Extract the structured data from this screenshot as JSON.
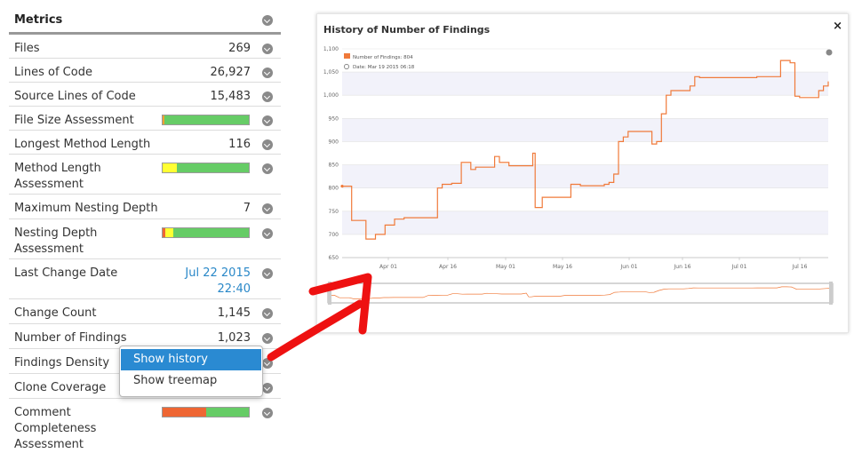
{
  "metrics": {
    "title": "Metrics",
    "rows": [
      {
        "label": "Files",
        "value": "269"
      },
      {
        "label": "Lines of Code",
        "value": "26,927"
      },
      {
        "label": "Source Lines of Code",
        "value": "15,483"
      },
      {
        "label": "File Size Assessment",
        "value": ""
      },
      {
        "label": "Longest Method Length",
        "value": "116"
      },
      {
        "label": "Method Length Assessment",
        "value": ""
      },
      {
        "label": "Maximum Nesting Depth",
        "value": "7"
      },
      {
        "label": "Nesting Depth Assessment",
        "value": ""
      },
      {
        "label": "Last Change Date",
        "value": "Jul 22 2015 22:40"
      },
      {
        "label": "Change Count",
        "value": "1,145"
      },
      {
        "label": "Number of Findings",
        "value": "1,023"
      },
      {
        "label": "Findings Density",
        "value": ""
      },
      {
        "label": "Clone Coverage",
        "value": ""
      },
      {
        "label": "Comment Completeness Assessment",
        "value": ""
      }
    ],
    "assessment_bars": {
      "file_size": [
        {
          "color": "#f0a030",
          "pct": 2
        },
        {
          "color": "#66cc66",
          "pct": 98
        }
      ],
      "method_length": [
        {
          "color": "#ffff33",
          "pct": 16
        },
        {
          "color": "#66cc66",
          "pct": 84
        }
      ],
      "nesting_depth": [
        {
          "color": "#ee6633",
          "pct": 3
        },
        {
          "color": "#ffff33",
          "pct": 9
        },
        {
          "color": "#66cc66",
          "pct": 88
        }
      ],
      "comment_completeness": [
        {
          "color": "#ee6633",
          "pct": 50
        },
        {
          "color": "#66cc66",
          "pct": 50
        }
      ]
    }
  },
  "context_menu": {
    "items": [
      {
        "label": "Show history",
        "selected": true
      },
      {
        "label": "Show treemap",
        "selected": false
      }
    ]
  },
  "history": {
    "title": "History of Number of Findings",
    "close": "×"
  },
  "chart_data": {
    "type": "line",
    "title": "History of Number of Findings",
    "legend": {
      "series": "Number of Findings: 804",
      "date": "Date: Mar 19 2015 06:18",
      "position": "top-left"
    },
    "y_ticks": [
      "1,100",
      "1,050",
      "1,000",
      "950",
      "900",
      "850",
      "800",
      "750",
      "700",
      "650"
    ],
    "ylim": [
      650,
      1100
    ],
    "x_ticks": [
      "Apr 01",
      "Apr 16",
      "May 01",
      "May 16",
      "Jun 01",
      "Jun 16",
      "Jul 01",
      "Jul 16"
    ],
    "grid": true,
    "series": [
      {
        "name": "Number of Findings",
        "color": "#f07a3a",
        "points": [
          [
            0,
            804
          ],
          [
            1,
            804
          ],
          [
            2,
            730
          ],
          [
            3,
            730
          ],
          [
            4,
            730
          ],
          [
            5,
            690
          ],
          [
            6,
            690
          ],
          [
            7,
            700
          ],
          [
            8,
            700
          ],
          [
            9,
            720
          ],
          [
            10,
            720
          ],
          [
            11,
            733
          ],
          [
            12,
            733
          ],
          [
            13,
            736
          ],
          [
            14,
            736
          ],
          [
            15,
            736
          ],
          [
            16,
            736
          ],
          [
            17,
            736
          ],
          [
            18,
            736
          ],
          [
            19,
            736
          ],
          [
            20,
            800
          ],
          [
            21,
            808
          ],
          [
            22,
            808
          ],
          [
            23,
            810
          ],
          [
            24,
            810
          ],
          [
            25,
            855
          ],
          [
            26,
            855
          ],
          [
            27,
            840
          ],
          [
            28,
            845
          ],
          [
            29,
            845
          ],
          [
            30,
            845
          ],
          [
            31,
            845
          ],
          [
            32,
            868
          ],
          [
            33,
            855
          ],
          [
            34,
            855
          ],
          [
            35,
            848
          ],
          [
            36,
            848
          ],
          [
            37,
            848
          ],
          [
            38,
            848
          ],
          [
            39,
            848
          ],
          [
            40,
            875
          ],
          [
            40.5,
            758
          ],
          [
            41,
            758
          ],
          [
            42,
            780
          ],
          [
            43,
            780
          ],
          [
            44,
            780
          ],
          [
            45,
            780
          ],
          [
            46,
            780
          ],
          [
            47,
            780
          ],
          [
            48,
            808
          ],
          [
            49,
            808
          ],
          [
            50,
            805
          ],
          [
            51,
            805
          ],
          [
            52,
            805
          ],
          [
            53,
            805
          ],
          [
            54,
            805
          ],
          [
            55,
            808
          ],
          [
            56,
            812
          ],
          [
            57,
            830
          ],
          [
            58,
            900
          ],
          [
            59,
            910
          ],
          [
            60,
            922
          ],
          [
            61,
            922
          ],
          [
            62,
            922
          ],
          [
            63,
            922
          ],
          [
            64,
            922
          ],
          [
            65,
            895
          ],
          [
            66,
            900
          ],
          [
            67,
            960
          ],
          [
            68,
            1000
          ],
          [
            69,
            1010
          ],
          [
            70,
            1010
          ],
          [
            71,
            1010
          ],
          [
            72,
            1010
          ],
          [
            73,
            1020
          ],
          [
            74,
            1040
          ],
          [
            75,
            1038
          ],
          [
            76,
            1038
          ],
          [
            77,
            1038
          ],
          [
            78,
            1038
          ],
          [
            79,
            1038
          ],
          [
            80,
            1038
          ],
          [
            81,
            1038
          ],
          [
            82,
            1038
          ],
          [
            83,
            1038
          ],
          [
            84,
            1038
          ],
          [
            85,
            1038
          ],
          [
            86,
            1038
          ],
          [
            87,
            1040
          ],
          [
            88,
            1040
          ],
          [
            89,
            1040
          ],
          [
            90,
            1040
          ],
          [
            91,
            1040
          ],
          [
            92,
            1075
          ],
          [
            93,
            1075
          ],
          [
            94,
            1070
          ],
          [
            95,
            998
          ],
          [
            96,
            995
          ],
          [
            97,
            995
          ],
          [
            98,
            995
          ],
          [
            99,
            995
          ],
          [
            100,
            1010
          ],
          [
            101,
            1020
          ],
          [
            102,
            1030
          ]
        ]
      }
    ]
  }
}
